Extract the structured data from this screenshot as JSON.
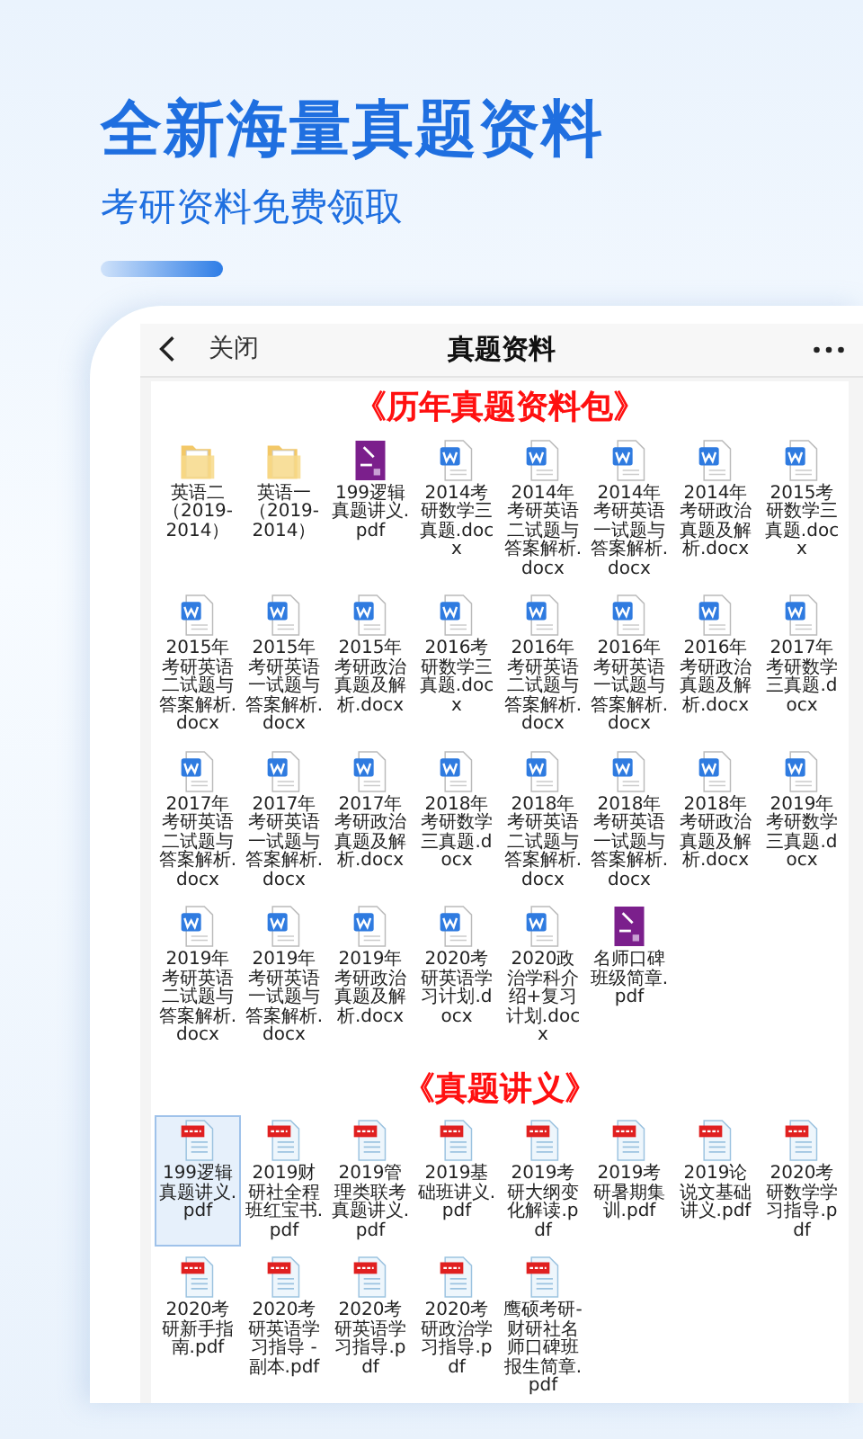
{
  "headline": "全新海量真题资料",
  "subheadline": "考研资料免费领取",
  "nav": {
    "back_label": "关闭",
    "title": "真题资料"
  },
  "sections": [
    {
      "title": "《历年真题资料包》",
      "files": [
        {
          "name": "英语二（2019-2014）",
          "kind": "folder",
          "selected": false
        },
        {
          "name": "英语一（2019-2014）",
          "kind": "folder",
          "selected": false
        },
        {
          "name": "199逻辑真题讲义.pdf",
          "kind": "cover",
          "selected": false
        },
        {
          "name": "2014考研数学三真题.docx",
          "kind": "word",
          "selected": false
        },
        {
          "name": "2014年考研英语二试题与答案解析.docx",
          "kind": "word",
          "selected": false
        },
        {
          "name": "2014年考研英语一试题与答案解析.docx",
          "kind": "word",
          "selected": false
        },
        {
          "name": "2014年考研政治真题及解析.docx",
          "kind": "word",
          "selected": false
        },
        {
          "name": "2015考研数学三真题.docx",
          "kind": "word",
          "selected": false
        },
        {
          "name": "2015年考研英语二试题与答案解析.docx",
          "kind": "word",
          "selected": false
        },
        {
          "name": "2015年考研英语一试题与答案解析.docx",
          "kind": "word",
          "selected": false
        },
        {
          "name": "2015年考研政治真题及解析.docx",
          "kind": "word",
          "selected": false
        },
        {
          "name": "2016考研数学三真题.docx",
          "kind": "word",
          "selected": false
        },
        {
          "name": "2016年考研英语二试题与答案解析.docx",
          "kind": "word",
          "selected": false
        },
        {
          "name": "2016年考研英语一试题与答案解析.docx",
          "kind": "word",
          "selected": false
        },
        {
          "name": "2016年考研政治真题及解析.docx",
          "kind": "word",
          "selected": false
        },
        {
          "name": "2017年考研数学三真题.docx",
          "kind": "word",
          "selected": false
        },
        {
          "name": "2017年考研英语二试题与答案解析.docx",
          "kind": "word",
          "selected": false
        },
        {
          "name": "2017年考研英语一试题与答案解析.docx",
          "kind": "word",
          "selected": false
        },
        {
          "name": "2017年考研政治真题及解析.docx",
          "kind": "word",
          "selected": false
        },
        {
          "name": "2018年考研数学三真题.docx",
          "kind": "word",
          "selected": false
        },
        {
          "name": "2018年考研英语二试题与答案解析.docx",
          "kind": "word",
          "selected": false
        },
        {
          "name": "2018年考研英语一试题与答案解析.docx",
          "kind": "word",
          "selected": false
        },
        {
          "name": "2018年考研政治真题及解析.docx",
          "kind": "word",
          "selected": false
        },
        {
          "name": "2019年考研数学三真题.docx",
          "kind": "word",
          "selected": false
        },
        {
          "name": "2019年考研英语二试题与答案解析.docx",
          "kind": "word",
          "selected": false
        },
        {
          "name": "2019年考研英语一试题与答案解析.docx",
          "kind": "word",
          "selected": false
        },
        {
          "name": "2019年考研政治真题及解析.docx",
          "kind": "word",
          "selected": false
        },
        {
          "name": "2020考研英语学习计划.docx",
          "kind": "word",
          "selected": false
        },
        {
          "name": "2020政治学科介绍+复习计划.docx",
          "kind": "word",
          "selected": false
        },
        {
          "name": "名师口碑班级简章.pdf",
          "kind": "cover",
          "selected": false
        }
      ]
    },
    {
      "title": "《真题讲义》",
      "files": [
        {
          "name": "199逻辑真题讲义.pdf",
          "kind": "pdf",
          "selected": true
        },
        {
          "name": "2019财研社全程班红宝书.pdf",
          "kind": "pdf",
          "selected": false
        },
        {
          "name": "2019管理类联考真题讲义.pdf",
          "kind": "pdf",
          "selected": false
        },
        {
          "name": "2019基础班讲义.pdf",
          "kind": "pdf",
          "selected": false
        },
        {
          "name": "2019考研大纲变化解读.pdf",
          "kind": "pdf",
          "selected": false
        },
        {
          "name": "2019考研暑期集训.pdf",
          "kind": "pdf",
          "selected": false
        },
        {
          "name": "2019论说文基础讲义.pdf",
          "kind": "pdf",
          "selected": false
        },
        {
          "name": "2020考研数学学习指导.pdf",
          "kind": "pdf",
          "selected": false
        },
        {
          "name": "2020考研新手指南.pdf",
          "kind": "pdf",
          "selected": false
        },
        {
          "name": "2020考研英语学习指导 - 副本.pdf",
          "kind": "pdf",
          "selected": false
        },
        {
          "name": "2020考研英语学习指导.pdf",
          "kind": "pdf",
          "selected": false
        },
        {
          "name": "2020考研政治学习指导.pdf",
          "kind": "pdf",
          "selected": false
        },
        {
          "name": "鹰硕考研-财研社名师口碑班报生简章.pdf",
          "kind": "pdf",
          "selected": false
        }
      ]
    }
  ]
}
